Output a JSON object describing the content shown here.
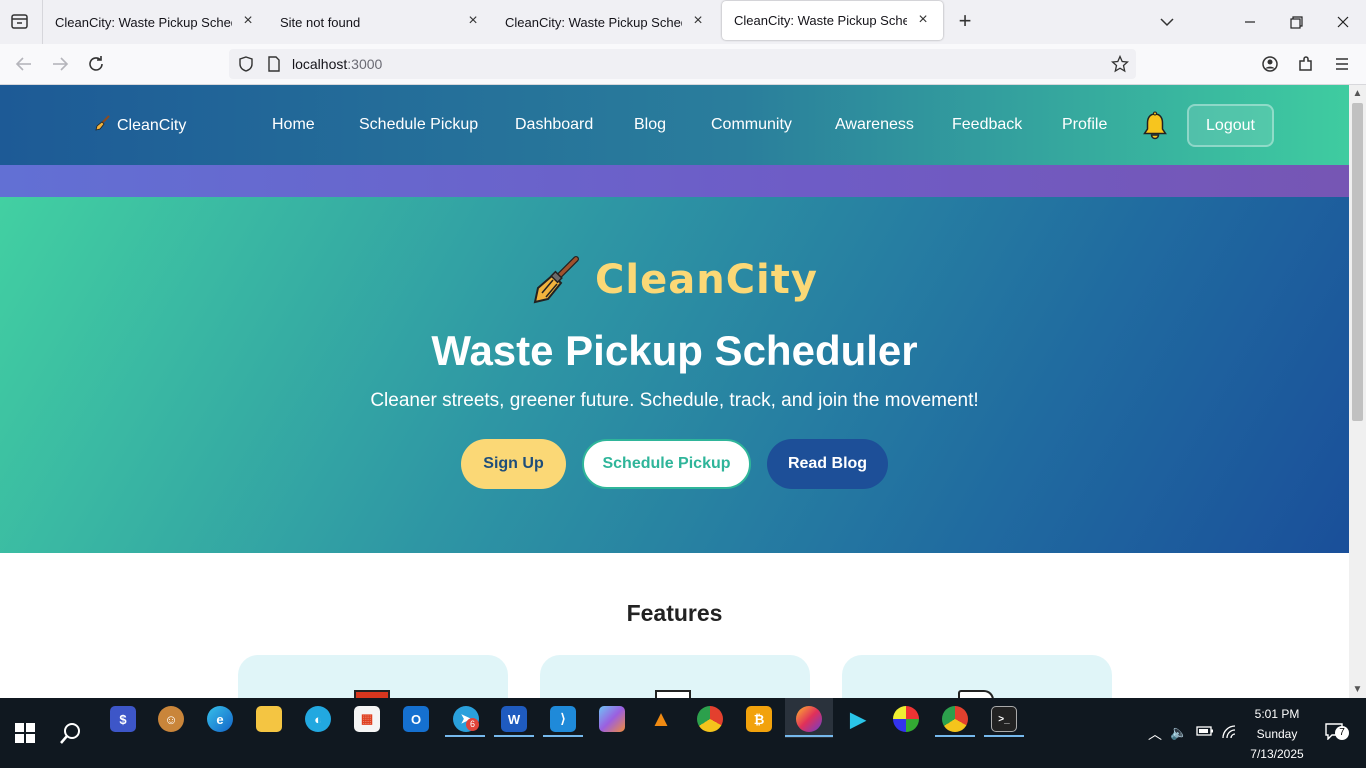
{
  "browser": {
    "tabs": [
      {
        "title": "CleanCity: Waste Pickup Scheduler",
        "active": false
      },
      {
        "title": "Site not found",
        "active": false
      },
      {
        "title": "CleanCity: Waste Pickup Scheduler",
        "active": false
      },
      {
        "title": "CleanCity: Waste Pickup Scheduler",
        "active": true
      }
    ],
    "url_host": "localhost",
    "url_port": ":3000"
  },
  "site": {
    "brand": "CleanCity",
    "nav": [
      "Home",
      "Schedule Pickup",
      "Dashboard",
      "Blog",
      "Community",
      "Awareness",
      "Feedback",
      "Profile"
    ],
    "logout_label": "Logout"
  },
  "hero": {
    "logo_text": "CleanCity",
    "title": "Waste Pickup Scheduler",
    "subtitle": "Cleaner streets, greener future. Schedule, track, and join the movement!",
    "buttons": {
      "signup": "Sign Up",
      "schedule": "Schedule Pickup",
      "blog": "Read Blog"
    }
  },
  "features": {
    "title": "Features"
  },
  "taskbar": {
    "icons": [
      "start-icon",
      "search-icon",
      "app-icon",
      "app-icon",
      "edge-icon",
      "file-explorer-icon",
      "app-icon",
      "store-icon",
      "outlook-icon",
      "telegram-icon",
      "word-icon",
      "vscode-icon",
      "copilot-icon",
      "vlc-icon",
      "chrome-icon",
      "app-icon",
      "firefox-icon",
      "app-icon",
      "app-icon",
      "chrome-icon",
      "terminal-icon"
    ],
    "telegram_badge": "6",
    "clock_time": "5:01 PM",
    "clock_day": "Sunday",
    "clock_date": "7/13/2025",
    "notification_count": "7"
  },
  "colors": {
    "header_left": "#1d5a96",
    "header_right": "#3fcca0",
    "accent_yellow": "#fbd876",
    "accent_teal": "#2fb59a",
    "accent_blue": "#1d4f98"
  }
}
